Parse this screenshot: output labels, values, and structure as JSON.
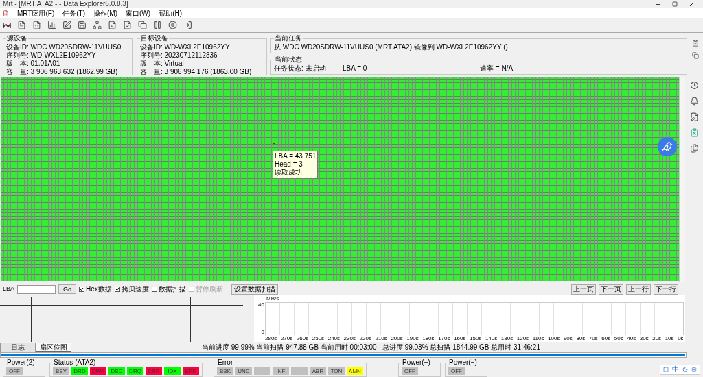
{
  "window": {
    "title": "Mrt - [MRT ATA2 -  - Data Explorer6.0.8.3]"
  },
  "menu": [
    "MRT应用(F)",
    "任务(T)",
    "操作(M)",
    "窗口(W)",
    "帮助(H)"
  ],
  "source": {
    "title": "源设备",
    "lines": [
      "设备ID: WDC WD20SDRW-11VUUS0",
      "序列号: WD-WXL2E10962YY",
      "版　本: 01.01A01",
      "容　量: 3 906 963 632 (1862.99 GB)"
    ]
  },
  "target": {
    "title": "目标设备",
    "lines": [
      "设备ID: WD-WXL2E10962YY",
      "序列号: 20230712112836",
      "版　本: Virtual",
      "容　量: 3 906 994 176 (1863.00 GB)"
    ]
  },
  "task": {
    "title": "当前任务",
    "text": "从 WDC WD20SDRW-11VUUS0 (MRT ATA2) 镜像到 WD-WXL2E10962YY ()"
  },
  "status": {
    "title": "当前状态",
    "state": "任务状态: 未启动",
    "lba": "LBA = 0",
    "rate": "速率 = N/A"
  },
  "tooltip": {
    "lines": [
      "LBA = 43 751",
      "Head = 3",
      "读取成功"
    ]
  },
  "controls": {
    "lba_label": "LBA",
    "go": "Go",
    "options": [
      {
        "label": "Hex数据",
        "checked": true,
        "disabled": false
      },
      {
        "label": "拷贝速度",
        "checked": true,
        "disabled": false
      },
      {
        "label": "数据扫描",
        "checked": false,
        "disabled": false
      },
      {
        "label": "暂停刷新",
        "checked": false,
        "disabled": true
      }
    ],
    "scan_button": "设置数据扫描",
    "nav": [
      "上一页",
      "下一页",
      "上一行",
      "下一行"
    ]
  },
  "speed_chart": {
    "unit": "MB/s",
    "y_ticks": [
      "40",
      "0"
    ],
    "x_ticks": [
      "280s",
      "270s",
      "260s",
      "250s",
      "240s",
      "230s",
      "220s",
      "210s",
      "200s",
      "190s",
      "180s",
      "170s",
      "160s",
      "150s",
      "140s",
      "130s",
      "120s",
      "110s",
      "100s",
      "90s",
      "80s",
      "70s",
      "60s",
      "50s",
      "40s",
      "30s",
      "20s",
      "10s",
      "0s"
    ]
  },
  "tabs": [
    {
      "label": "日志",
      "selected": false
    },
    {
      "label": "扇区位图",
      "selected": true
    }
  ],
  "progress_text": "当前进度 99.99% 当前扫描 947.88 GB 当前用时 00:03:00   总进度 99.03% 总扫描 1844.99 GB 总用时 31:46:21",
  "progress": {
    "level": 1
  },
  "indicator_groups": [
    {
      "title": "Power(2)",
      "items": [
        {
          "text": "OFF",
          "color": "#c0c0c0"
        }
      ]
    },
    {
      "title": "Status (ATA2)",
      "items": [
        {
          "text": "BSY",
          "color": "#c0c0c0"
        },
        {
          "text": "DRD",
          "color": "#00ff00"
        },
        {
          "text": "DWF",
          "color": "#ff0040"
        },
        {
          "text": "DSC",
          "color": "#00ff00"
        },
        {
          "text": "DRQ",
          "color": "#00ff00"
        },
        {
          "text": "CRR",
          "color": "#ff0040"
        },
        {
          "text": "IDX",
          "color": "#00ff00"
        },
        {
          "text": "ERR",
          "color": "#ff0040"
        }
      ]
    },
    {
      "title": "Error",
      "items": [
        {
          "text": "BBK",
          "color": "#c0c0c0"
        },
        {
          "text": "UNC",
          "color": "#c0c0c0"
        },
        {
          "color": "#c0c0c0"
        },
        {
          "text": "INF",
          "color": "#c0c0c0"
        },
        {
          "color": "#c0c0c0"
        },
        {
          "text": "ABR",
          "color": "#c0c0c0"
        },
        {
          "text": "TON",
          "color": "#c0c0c0"
        },
        {
          "text": "AMN",
          "color": "#ffff00"
        }
      ]
    },
    {
      "title": "Power(−)",
      "items": [
        {
          "text": "OFF",
          "color": "#c0c0c0"
        }
      ]
    },
    {
      "title": "Power(−)",
      "items": [
        {
          "text": "OFF",
          "color": "#c0c0c0"
        }
      ]
    }
  ],
  "tray": [
    "中"
  ]
}
